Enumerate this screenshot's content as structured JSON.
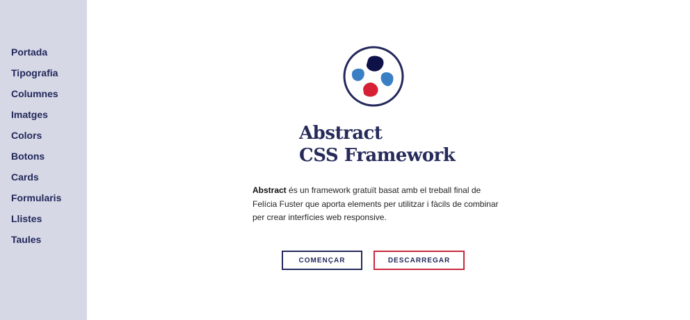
{
  "sidebar": {
    "items": [
      {
        "label": "Portada"
      },
      {
        "label": "Tipografia"
      },
      {
        "label": "Columnes"
      },
      {
        "label": "Imatges"
      },
      {
        "label": "Colors"
      },
      {
        "label": "Botons"
      },
      {
        "label": "Cards"
      },
      {
        "label": "Formularis"
      },
      {
        "label": "Llistes"
      },
      {
        "label": "Taules"
      }
    ]
  },
  "hero": {
    "logo_icon": "abstract-logo-icon",
    "title_line1": "Abstract",
    "title_line2": "CSS Framework",
    "description_strong": "Abstract",
    "description_rest": " és un framework gratuït basat amb el treball final de Felícia Fuster que aporta elements per utilitzar i fàcils de combinar per crear interfícies web responsive.",
    "start_button": "COMENÇAR",
    "download_button": "DESCARREGAR"
  },
  "colors": {
    "sidebar_bg": "#d6d8e6",
    "navy": "#22285a",
    "blue": "#3a7fc4",
    "red": "#d62035"
  }
}
